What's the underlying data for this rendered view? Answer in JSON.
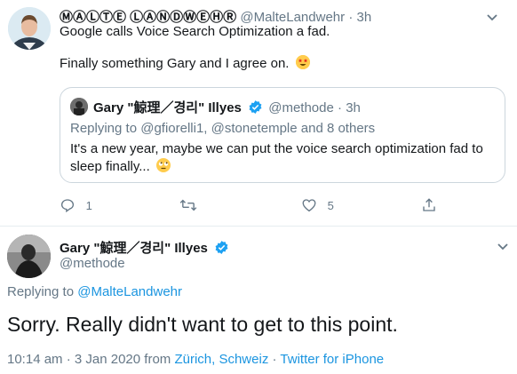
{
  "tweet1": {
    "author_display": "ⓂⒶⓁⓉⒺ ⓁⒶⓃⒹⓌⒺⒽⓇ",
    "handle": "@MalteLandwehr",
    "separator": "·",
    "time": "3h",
    "line1": "Google calls Voice Search Optimization a fad.",
    "line2": "Finally something Gary and I agree on.",
    "emoji": "star-struck-emoji"
  },
  "quote": {
    "author": "Gary \"鯨理／경리\" Illyes",
    "handle": "@methode",
    "separator": "·",
    "time": "3h",
    "replying_prefix": "Replying to",
    "replying_users": "@gfiorelli1, @stonetemple",
    "replying_suffix": "and 8 others",
    "text_line1": "It's a new year, maybe we can put the voice search optimization fad to",
    "text_line2": "sleep finally...",
    "emoji": "rolling-eyes-emoji"
  },
  "actions": {
    "reply_count": "1",
    "retweet_count": "",
    "like_count": "5"
  },
  "tweet2": {
    "author": "Gary \"鯨理／경리\" Illyes",
    "handle": "@methode",
    "replying_prefix": "Replying to",
    "replying_user": "@MalteLandwehr",
    "text": "Sorry. Really didn't want to get to this point.",
    "timestamp": "10:14 am · 3 Jan 2020",
    "from_label": "from",
    "location": "Zürich, Schweiz",
    "dot": "·",
    "client": "Twitter for iPhone"
  },
  "colors": {
    "link": "#1b95e0",
    "muted": "#657786",
    "border": "#ccd6dd",
    "verified": "#1da1f2"
  }
}
